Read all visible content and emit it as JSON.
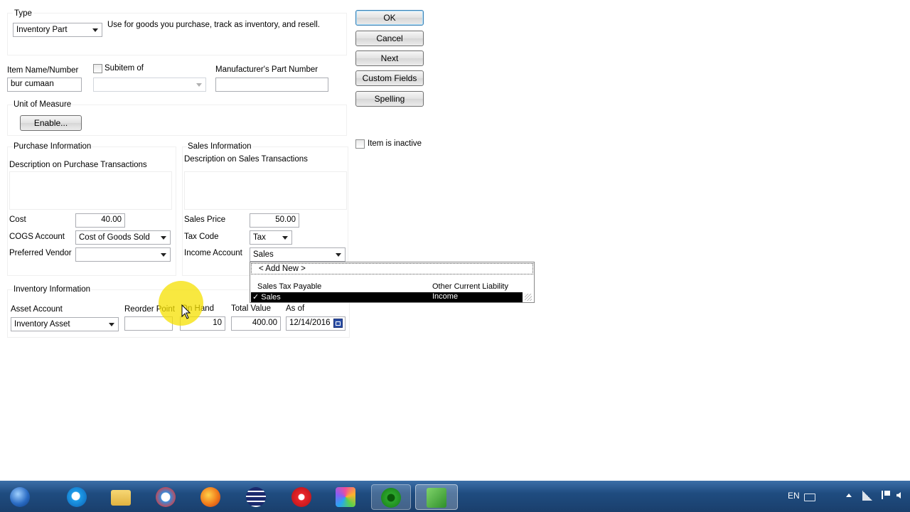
{
  "type_section": {
    "label": "Type",
    "value": "Inventory Part",
    "description": "Use for goods you purchase, track as inventory, and resell."
  },
  "buttons": {
    "ok": "OK",
    "cancel": "Cancel",
    "next": "Next",
    "custom_fields": "Custom Fields",
    "spelling": "Spelling"
  },
  "item_inactive": {
    "label": "Item is inactive",
    "checked": false
  },
  "item": {
    "name_label": "Item Name/Number",
    "name_value": "bur cumaan",
    "subitem_label": "Subitem of",
    "subitem_value": "",
    "mpn_label": "Manufacturer's Part Number",
    "mpn_value": ""
  },
  "unit_of_measure": {
    "label": "Unit of Measure",
    "button": "Enable..."
  },
  "purchase": {
    "title": "Purchase Information",
    "desc_label": "Description on Purchase Transactions",
    "desc_value": "",
    "cost_label": "Cost",
    "cost_value": "40.00",
    "cogs_label": "COGS Account",
    "cogs_value": "Cost of Goods Sold",
    "vendor_label": "Preferred Vendor",
    "vendor_value": ""
  },
  "sales": {
    "title": "Sales Information",
    "desc_label": "Description on Sales Transactions",
    "desc_value": "",
    "price_label": "Sales Price",
    "price_value": "50.00",
    "tax_label": "Tax Code",
    "tax_value": "Tax",
    "income_label": "Income Account",
    "income_value": "Sales"
  },
  "income_dropdown": {
    "add_new": "< Add New >",
    "options": [
      {
        "name": "Sales Tax Payable",
        "type": "Other Current Liability",
        "selected": false
      },
      {
        "name": "✓ Sales",
        "type": "Income",
        "selected": true
      }
    ]
  },
  "inventory": {
    "title": "Inventory Information",
    "asset_label": "Asset Account",
    "asset_value": "Inventory Asset",
    "reorder_label": "Reorder Point",
    "reorder_value": "",
    "onhand_label": "On Hand",
    "onhand_value": "10",
    "total_label": "Total Value",
    "total_value": "400.00",
    "asof_label": "As of",
    "asof_value": "12/14/2016"
  },
  "taskbar": {
    "language": "EN",
    "icons": [
      "start-orb-icon",
      "internet-explorer-icon",
      "file-explorer-icon",
      "browser-swirl-icon",
      "firefox-icon",
      "media-player-icon",
      "yandex-icon",
      "pinwheel-app-icon",
      "quickbooks-icon",
      "spreadsheet-icon"
    ]
  },
  "colors": {
    "selection": "#000000",
    "taskbar": "#1f4c80",
    "cursor_highlight": "#f5e000"
  }
}
